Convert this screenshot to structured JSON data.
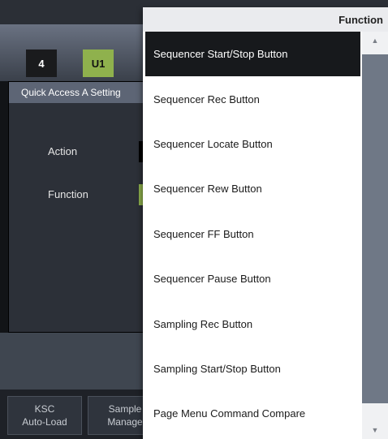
{
  "tabs": [
    "4",
    "U1"
  ],
  "setting": {
    "title": "Quick Access A Setting",
    "action_label": "Action",
    "function_label": "Function"
  },
  "bottom_buttons": [
    {
      "line1": "KSC",
      "line2": "Auto-Load"
    },
    {
      "line1": "Sample",
      "line2": "Manage"
    }
  ],
  "dropdown": {
    "title": "Function",
    "selected_index": 0,
    "items": [
      "Sequencer Start/Stop Button",
      "Sequencer Rec Button",
      "Sequencer Locate Button",
      "Sequencer Rew Button",
      "Sequencer FF Button",
      "Sequencer Pause Button",
      "Sampling Rec Button",
      "Sampling Start/Stop Button",
      "Page Menu Command Compare"
    ]
  },
  "colors": {
    "accent_green": "#8fb14d",
    "selected_bg": "#17191c",
    "scroll_thumb": "#6f7886"
  },
  "icons": {
    "scroll_up": "triangle-up-icon",
    "scroll_down": "triangle-down-icon"
  }
}
